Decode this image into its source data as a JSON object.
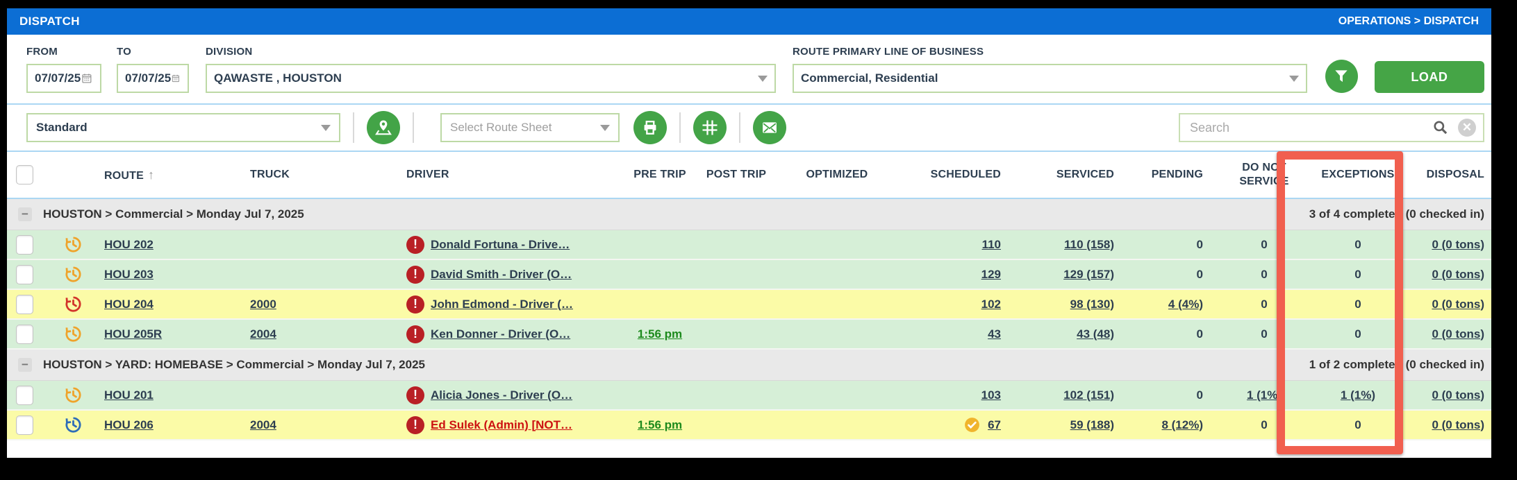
{
  "titlebar": {
    "title": "DISPATCH",
    "breadcrumb": "OPERATIONS > DISPATCH"
  },
  "filters": {
    "from_label": "FROM",
    "from_value": "07/07/25",
    "to_label": "TO",
    "to_value": "07/07/25",
    "division_label": "DIVISION",
    "division_value": "QAWASTE , HOUSTON",
    "lob_label": "ROUTE PRIMARY LINE OF BUSINESS",
    "lob_value": "Commercial, Residential",
    "load_label": "LOAD"
  },
  "toolbar": {
    "view_value": "Standard",
    "route_sheet_placeholder": "Select Route Sheet",
    "search_placeholder": "Search"
  },
  "icons": {
    "calendar": "calendar-icon",
    "filter": "funnel-icon",
    "map_pin": "map-pin-icon",
    "printer": "printer-icon",
    "route_builder": "route-intersection-icon",
    "email": "envelope-icon",
    "search": "magnifier-icon",
    "clear": "clear-circle-icon",
    "sort_asc": "up-arrow",
    "collapse": "minus",
    "clock": "clock-history-icon",
    "driver_alert": "exclamation-circle-icon",
    "checked_in": "check-circle-icon"
  },
  "colors": {
    "titlebar_blue": "#0c6ed4",
    "accent_green": "#43a447",
    "row_green": "#d6efd7",
    "row_yellow": "#fbfba7",
    "highlight_red": "#f15f4f",
    "clock_orange": "#efa32b",
    "clock_red": "#d2342b",
    "clock_blue": "#2e6db8"
  },
  "table": {
    "columns": [
      "ROUTE",
      "TRUCK",
      "DRIVER",
      "PRE TRIP",
      "POST TRIP",
      "OPTIMIZED",
      "SCHEDULED",
      "SERVICED",
      "PENDING",
      "DO NOT SERVICE",
      "EXCEPTIONS",
      "DISPOSAL"
    ],
    "groups": [
      {
        "label": "HOUSTON > Commercial > Monday Jul 7, 2025",
        "summary": "3 of 4 completed (0 checked in)",
        "rows": [
          {
            "route": "HOU 202",
            "truck": "",
            "driver": "Donald Fortuna - Drive…",
            "driver_alert": true,
            "driver_color": "dark",
            "clock": "orange",
            "pre_trip": "",
            "post_trip": "",
            "optimized": "",
            "checked_in": false,
            "scheduled": "110",
            "serviced": "110 (158)",
            "pending": "0",
            "do_not_service": "0",
            "exceptions": "0",
            "disposal": "0 (0 tons)",
            "row_color": "green"
          },
          {
            "route": "HOU 203",
            "truck": "",
            "driver": "David Smith - Driver (O…",
            "driver_alert": true,
            "driver_color": "dark",
            "clock": "orange",
            "pre_trip": "",
            "post_trip": "",
            "optimized": "",
            "checked_in": false,
            "scheduled": "129",
            "serviced": "129 (157)",
            "pending": "0",
            "do_not_service": "0",
            "exceptions": "0",
            "disposal": "0 (0 tons)",
            "row_color": "green"
          },
          {
            "route": "HOU 204",
            "truck": "2000",
            "driver": "John Edmond - Driver (…",
            "driver_alert": true,
            "driver_color": "dark",
            "clock": "red",
            "pre_trip": "",
            "post_trip": "",
            "optimized": "",
            "checked_in": false,
            "scheduled": "102",
            "serviced": "98 (130)",
            "pending": "4 (4%)",
            "do_not_service": "0",
            "exceptions": "0",
            "disposal": "0 (0 tons)",
            "row_color": "yellow"
          },
          {
            "route": "HOU 205R",
            "truck": "2004",
            "driver": "Ken Donner - Driver (O…",
            "driver_alert": true,
            "driver_color": "dark",
            "clock": "orange",
            "pre_trip": "1:56 pm",
            "post_trip": "",
            "optimized": "",
            "checked_in": false,
            "scheduled": "43",
            "serviced": "43 (48)",
            "pending": "0",
            "do_not_service": "0",
            "exceptions": "0",
            "disposal": "0 (0 tons)",
            "row_color": "green"
          }
        ]
      },
      {
        "label": "HOUSTON > YARD: HOMEBASE > Commercial > Monday Jul 7, 2025",
        "summary": "1 of 2 completed (0 checked in)",
        "rows": [
          {
            "route": "HOU 201",
            "truck": "",
            "driver": "Alicia Jones - Driver (O…",
            "driver_alert": true,
            "driver_color": "dark",
            "clock": "orange",
            "pre_trip": "",
            "post_trip": "",
            "optimized": "",
            "checked_in": false,
            "scheduled": "103",
            "serviced": "102 (151)",
            "pending": "0",
            "do_not_service": "1 (1%)",
            "exceptions": "1 (1%)",
            "disposal": "0 (0 tons)",
            "row_color": "green"
          },
          {
            "route": "HOU 206",
            "truck": "2004",
            "driver": "Ed Sulek (Admin) [NOT…",
            "driver_alert": true,
            "driver_color": "red",
            "clock": "blue",
            "pre_trip": "1:56 pm",
            "post_trip": "",
            "optimized": "",
            "checked_in": true,
            "scheduled": "67",
            "serviced": "59 (188)",
            "pending": "8 (12%)",
            "do_not_service": "0",
            "exceptions": "0",
            "disposal": "0 (0 tons)",
            "row_color": "yellow"
          }
        ]
      }
    ]
  }
}
